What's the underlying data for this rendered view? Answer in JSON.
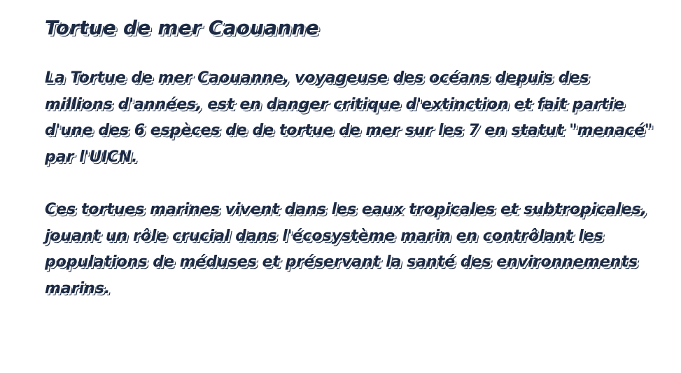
{
  "slide": {
    "title": "Tortue de mer Caouanne",
    "paragraphs": [
      "La Tortue de mer Caouanne, voyageuse des océans depuis des millions d'années, est en danger critique d'extinction et fait partie d'une des 6 espèces de de tortue de mer sur les 7 en statut \"menacé\" par l'UICN.",
      "Ces tortues marines vivent dans les eaux tropicales et subtropicales, jouant un rôle crucial dans l'écosystème marin en contrôlant les populations de méduses et préservant la santé des environnements marins."
    ]
  },
  "colors": {
    "text": "#1c2a44",
    "background": "#ffffff"
  }
}
